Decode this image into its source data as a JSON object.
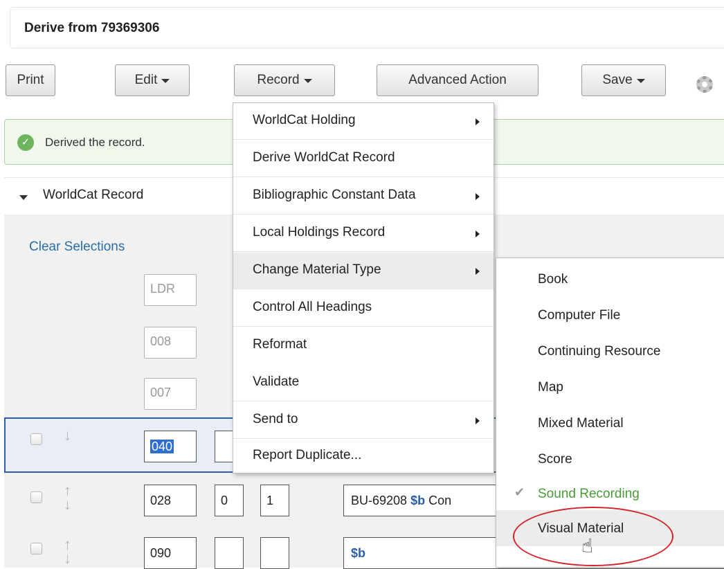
{
  "header": {
    "title": "Derive from 79369306"
  },
  "toolbar": {
    "print": "Print",
    "edit": "Edit",
    "record": "Record",
    "advanced": "Advanced Action",
    "save": "Save",
    "settings_icon": "gear-icon"
  },
  "alert": {
    "message": "Derived the record.",
    "status": "success"
  },
  "section": {
    "title": "WorldCat Record"
  },
  "editor": {
    "clear_link": "Clear Selections",
    "fixed_tags": [
      "LDR",
      "008",
      "007"
    ],
    "rows": [
      {
        "tag": "040",
        "ind1": "",
        "ind2": "",
        "content_prefix": "",
        "subfield": "",
        "content_suffix": ""
      },
      {
        "tag": "028",
        "ind1": "0",
        "ind2": "1",
        "content_prefix": "BU-69208 ",
        "subfield": "$b",
        "content_suffix": " Con"
      },
      {
        "tag": "090",
        "ind1": "",
        "ind2": "",
        "content_prefix": "",
        "subfield": "$b",
        "content_suffix": ""
      }
    ]
  },
  "record_menu": {
    "items": [
      {
        "label": "WorldCat Holding",
        "has_submenu": true
      },
      {
        "label": "Derive WorldCat Record",
        "has_submenu": false
      },
      {
        "label": "Bibliographic Constant Data",
        "has_submenu": true
      },
      {
        "label": "Local Holdings Record",
        "has_submenu": true
      },
      {
        "label": "Change Material Type",
        "has_submenu": true,
        "highlighted": true
      },
      {
        "label": "Control All Headings",
        "has_submenu": false
      },
      {
        "label": "Reformat",
        "has_submenu": false
      },
      {
        "label": "Validate",
        "has_submenu": false
      },
      {
        "label": "Send to",
        "has_submenu": true
      },
      {
        "label": "Report Duplicate...",
        "has_submenu": false
      }
    ]
  },
  "material_submenu": {
    "items": [
      {
        "label": "Book"
      },
      {
        "label": "Computer File"
      },
      {
        "label": "Continuing Resource"
      },
      {
        "label": "Map"
      },
      {
        "label": "Mixed Material"
      },
      {
        "label": "Score"
      },
      {
        "label": "Sound Recording",
        "checked": true
      },
      {
        "label": "Visual Material",
        "hover": true
      }
    ]
  },
  "colors": {
    "accent_blue": "#2f5fa8",
    "success_green": "#4a9a3a",
    "annotation_red": "#d6232a"
  }
}
